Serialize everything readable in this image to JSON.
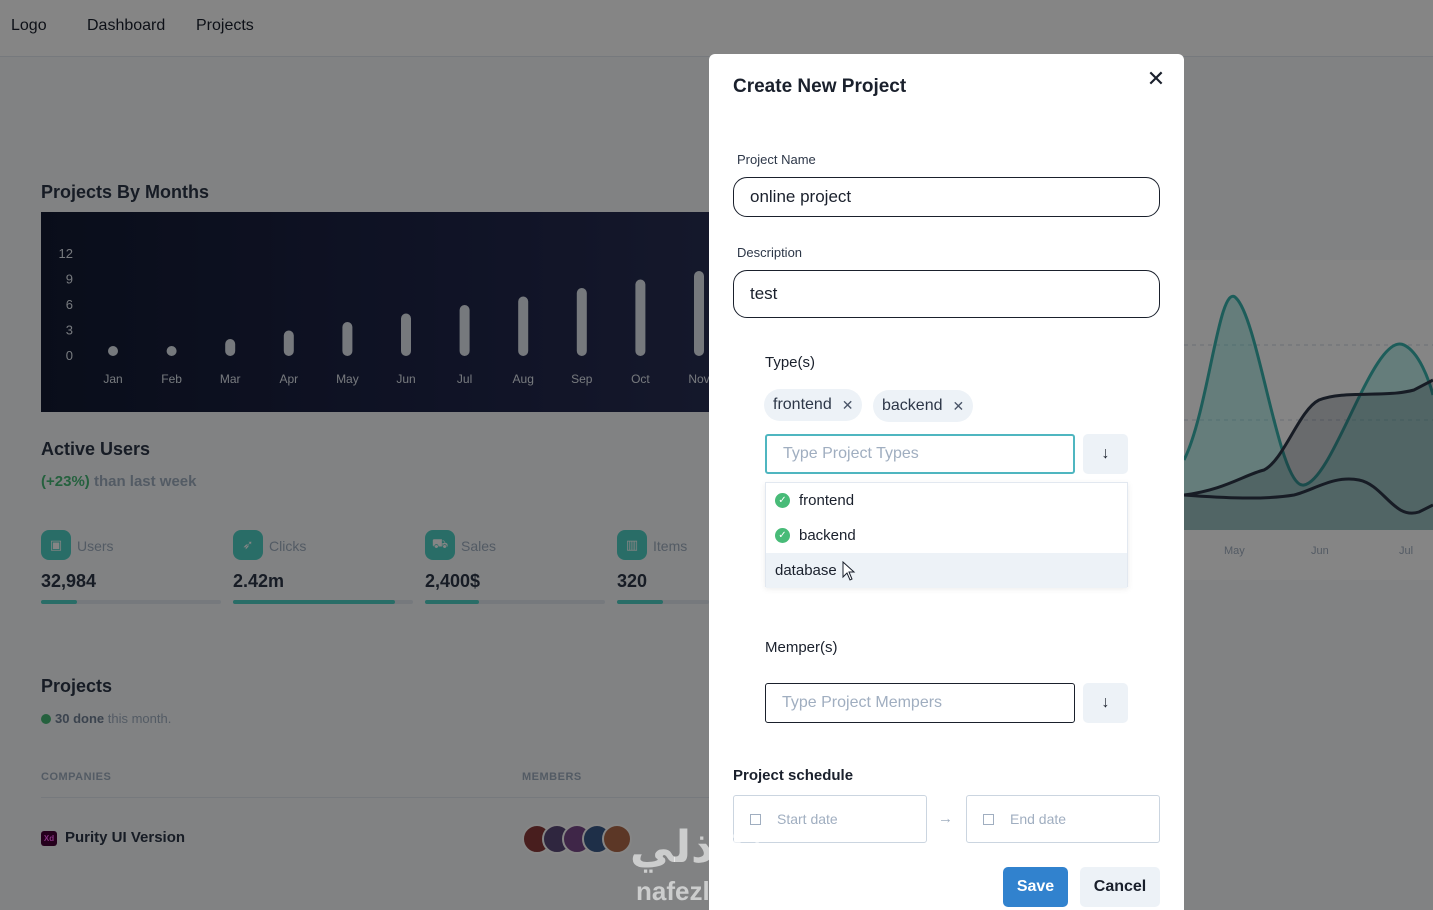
{
  "topnav": {
    "logo": "Logo",
    "items": [
      "Dashboard",
      "Projects"
    ]
  },
  "projects_by_months": {
    "title": "Projects By Months",
    "chart_data": {
      "type": "bar",
      "categories": [
        "Jan",
        "Feb",
        "Mar",
        "Apr",
        "May",
        "Jun",
        "Jul",
        "Aug",
        "Sep",
        "Oct",
        "Nov"
      ],
      "values": [
        0,
        1,
        2,
        3,
        4,
        5,
        6,
        7,
        8,
        9,
        10
      ],
      "yticks": [
        0,
        3,
        6,
        9,
        12
      ],
      "ylim": [
        0,
        12
      ],
      "grid": false,
      "colors": {
        "bar": "#e2e8f0",
        "background": "#171d3b"
      }
    }
  },
  "active_users": {
    "title": "Active Users",
    "change": "(+23%)",
    "subtitle": "than last week",
    "stats": [
      {
        "label": "Users",
        "value": "32,984",
        "icon": "wallet-icon",
        "progress": 0.2
      },
      {
        "label": "Clicks",
        "value": "2.42m",
        "icon": "rocket-icon",
        "progress": 0.9
      },
      {
        "label": "Sales",
        "value": "2,400$",
        "icon": "cart-icon",
        "progress": 0.3
      },
      {
        "label": "Items",
        "value": "320",
        "icon": "bar-chart-icon",
        "progress": 0.5
      }
    ]
  },
  "projects": {
    "title": "Projects",
    "done_count": "30 done",
    "done_suffix": "this month.",
    "columns": [
      "COMPANIES",
      "MEMBERS"
    ],
    "rows": [
      {
        "company": "Purity UI Version"
      }
    ]
  },
  "right_chart": {
    "x_labels": [
      "May",
      "Jun",
      "Jul"
    ]
  },
  "modal": {
    "title": "Create New Project",
    "project_name_label": "Project Name",
    "project_name_value": "online project",
    "description_label": "Description",
    "description_value": "test",
    "types_label": "Type(s)",
    "selected_types": [
      "frontend",
      "backend"
    ],
    "types_placeholder": "Type Project Types",
    "type_options": [
      {
        "label": "frontend",
        "selected": true
      },
      {
        "label": "backend",
        "selected": true
      },
      {
        "label": "database",
        "selected": false
      }
    ],
    "members_label": "Memper(s)",
    "members_placeholder": "Type Project Mempers",
    "schedule_label": "Project schedule",
    "start_placeholder": "Start date",
    "end_placeholder": "End date",
    "save_label": "Save",
    "cancel_label": "Cancel"
  },
  "watermark": {
    "arabic": "نفذلي",
    "latin": "nafezly.com"
  },
  "colors": {
    "accent": "#4fd1c5",
    "primary": "#3182ce",
    "success": "#48bb78"
  }
}
